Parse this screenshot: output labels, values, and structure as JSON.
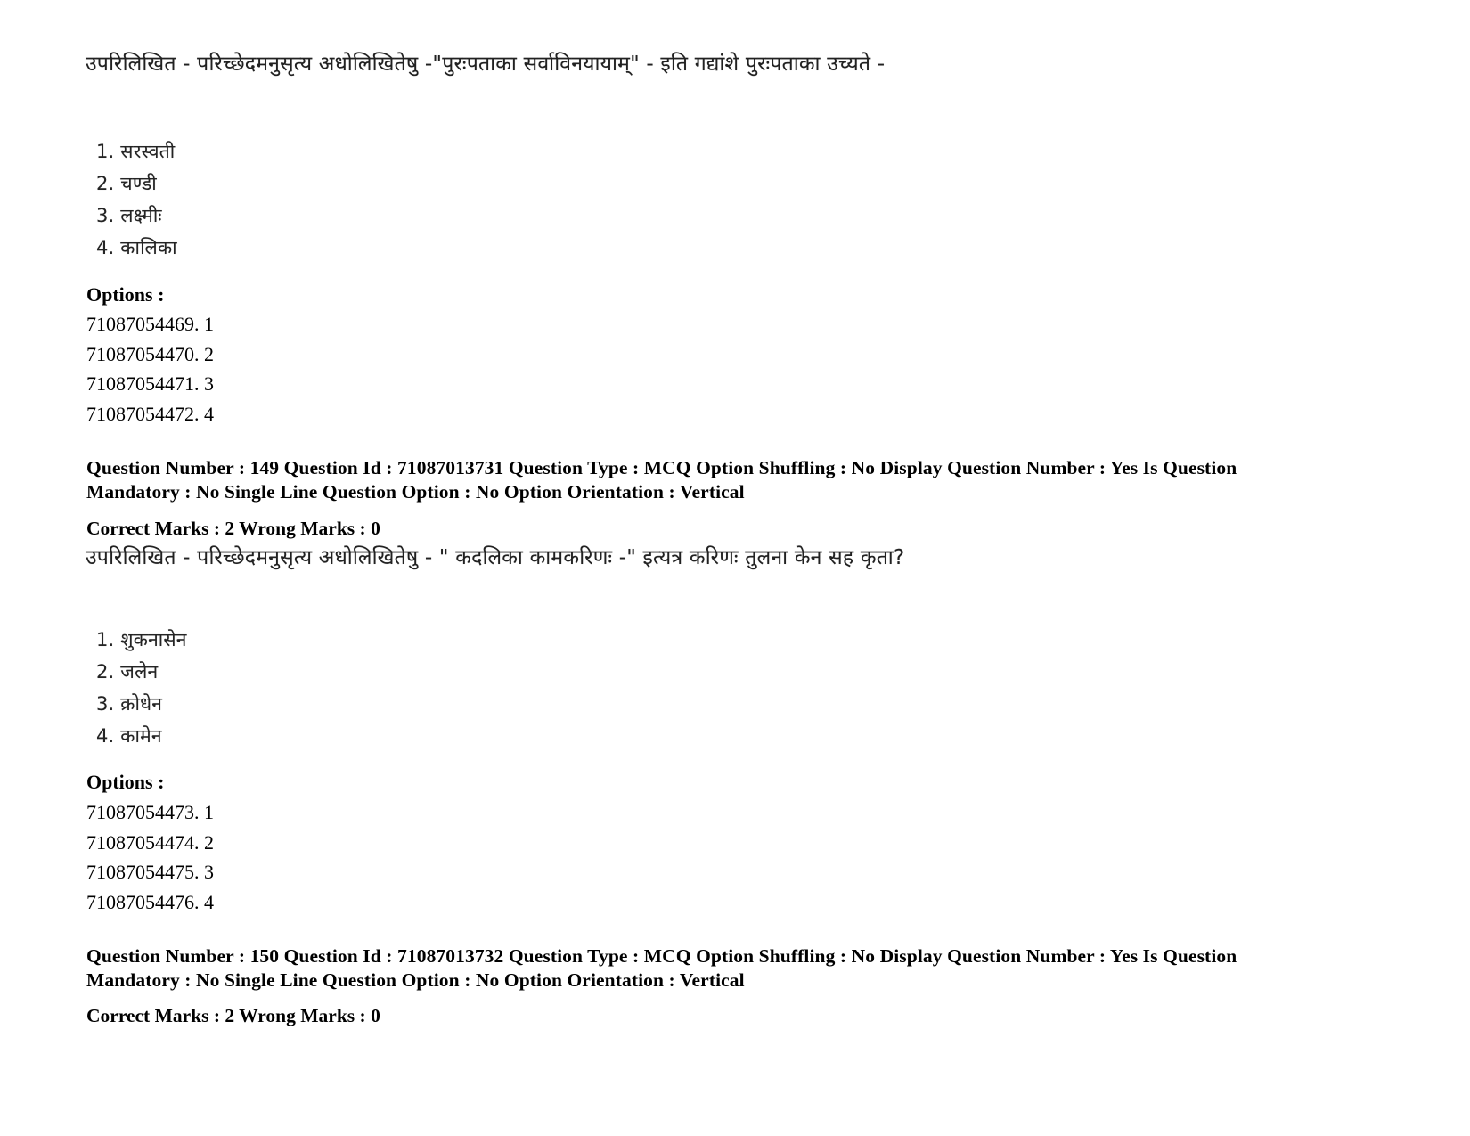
{
  "document": {
    "type": "exam-question-paper-printout"
  },
  "question_148": {
    "stem": "उपरिलिखित - परिच्छेदमनुसृत्य अधोलिखितेषु -\"पुरःपताका सर्वाविनयायाम्\" - इति गद्यांशे पुरःपताका उच्यते -",
    "choices": [
      "1. सरस्वती",
      "2. चण्डी",
      "3. लक्ष्मीः",
      "4. कालिका"
    ],
    "options_label": "Options :",
    "option_ids": [
      "71087054469. 1",
      "71087054470. 2",
      "71087054471. 3",
      "71087054472. 4"
    ]
  },
  "question_149": {
    "meta_line_1": "Question Number : 149 Question Id : 71087013731 Question Type : MCQ Option Shuffling : No Display Question Number : Yes Is Question Mandatory : No Single Line Question Option : No Option Orientation : Vertical",
    "marks_line": "Correct Marks : 2 Wrong Marks : 0",
    "stem": "उपरिलिखित - परिच्छेदमनुसृत्य अधोलिखितेषु - \" कदलिका कामकरिणः -\" इत्यत्र करिणः तुलना केन सह कृता?",
    "choices": [
      "1. शुकनासेन",
      "2. जलेन",
      "3. क्रोधेन",
      "4. कामेन"
    ],
    "options_label": "Options :",
    "option_ids": [
      "71087054473. 1",
      "71087054474. 2",
      "71087054475. 3",
      "71087054476. 4"
    ]
  },
  "question_150": {
    "meta_line_1": "Question Number : 150 Question Id : 71087013732 Question Type : MCQ Option Shuffling : No Display Question Number : Yes Is Question Mandatory : No Single Line Question Option : No Option Orientation : Vertical",
    "marks_line": "Correct Marks : 2 Wrong Marks : 0"
  }
}
